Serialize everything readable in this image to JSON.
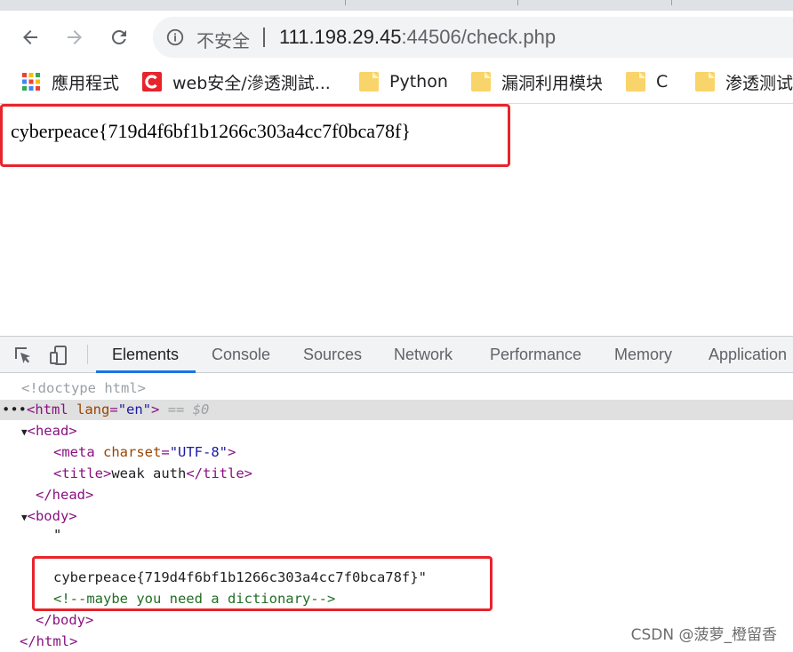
{
  "browser": {
    "address_bar": {
      "security_label": "不安全",
      "url_host": "111.198.29.45",
      "url_rest": ":44506/check.php"
    },
    "bookmarks": [
      {
        "label": "應用程式",
        "icon": "apps-grid-icon"
      },
      {
        "label": "web安全/滲透測試...",
        "icon": "csdn-logo-icon"
      },
      {
        "label": "Python",
        "icon": "folder-icon"
      },
      {
        "label": "漏洞利用模块",
        "icon": "folder-icon"
      },
      {
        "label": "C",
        "icon": "folder-icon"
      },
      {
        "label": "渗透测试",
        "icon": "folder-icon"
      }
    ]
  },
  "page": {
    "flag_text": "cyberpeace{719d4f6bf1b1266c303a4cc7f0bca78f}"
  },
  "devtools": {
    "tabs": [
      "Elements",
      "Console",
      "Sources",
      "Network",
      "Performance",
      "Memory",
      "Application"
    ],
    "active_tab": "Elements",
    "dom": {
      "doctype": "<!doctype html>",
      "html_open": "<html",
      "html_attr": "lang",
      "html_attr_val": "\"en\"",
      "html_close_bracket": ">",
      "selected_marker": "== $0",
      "head_open": "<head>",
      "meta_open": "<meta",
      "meta_attr": "charset",
      "meta_attr_val": "\"UTF-8\"",
      "meta_close": ">",
      "title_open": "<title>",
      "title_text": "weak auth",
      "title_close": "</title>",
      "head_close": "</head>",
      "body_open": "<body>",
      "quote_open": "\"",
      "flag_line": "cyberpeace{719d4f6bf1b1266c303a4cc7f0bca78f}\"",
      "comment": "<!--maybe you need a dictionary-->",
      "body_close": "</body>",
      "html_close": "</html>"
    }
  },
  "watermark": "CSDN @菠萝_橙留香",
  "colors": {
    "highlight_border": "#e8242b",
    "active_tab_underline": "#1a73e8",
    "tag": "#881280",
    "attr": "#994500",
    "comment": "#236e25"
  }
}
